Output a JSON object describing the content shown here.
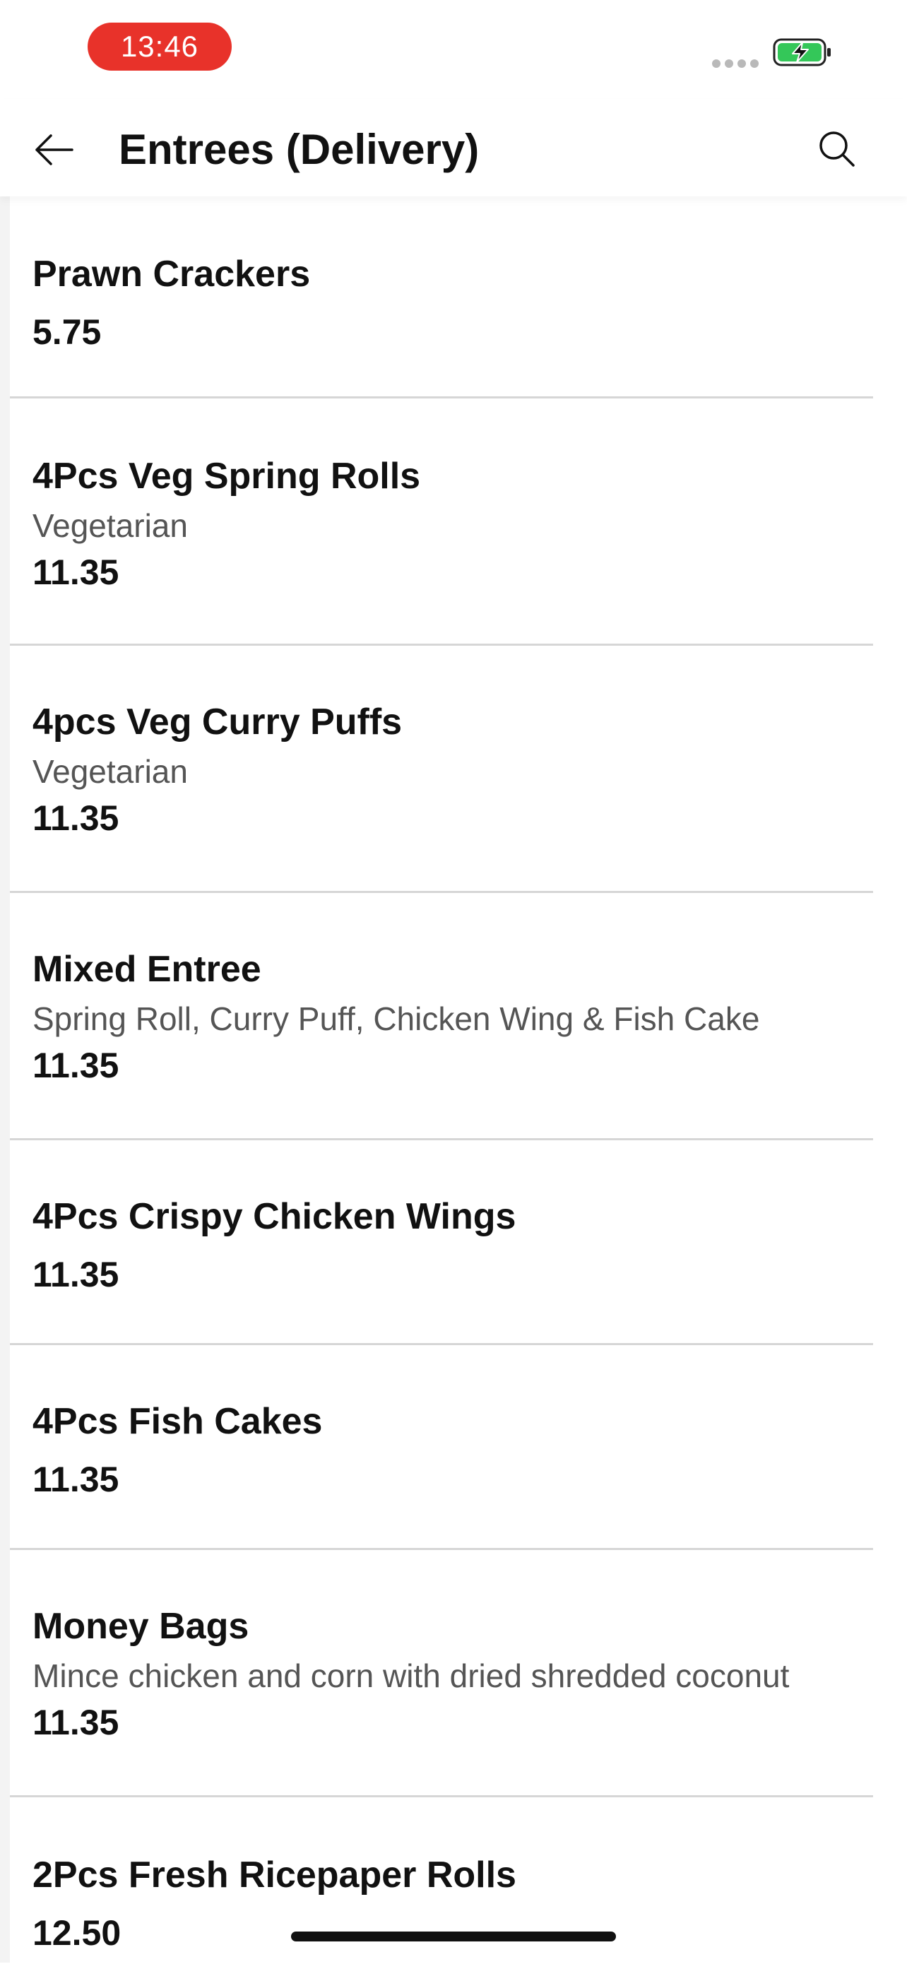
{
  "status_bar": {
    "time": "13:46",
    "time_pill_color": "#e8322a",
    "battery_color": "#34c759",
    "battery_icon": "battery-charging-icon"
  },
  "header": {
    "title": "Entrees (Delivery)",
    "back_icon": "arrow-left-icon",
    "search_icon": "search-icon"
  },
  "items": [
    {
      "name": "Prawn Crackers",
      "description": "",
      "price": "5.75"
    },
    {
      "name": "4Pcs Veg Spring Rolls",
      "description": "Vegetarian",
      "price": "11.35"
    },
    {
      "name": "4pcs Veg Curry Puffs",
      "description": "Vegetarian",
      "price": "11.35"
    },
    {
      "name": "Mixed Entree",
      "description": "Spring Roll, Curry Puff, Chicken Wing & Fish Cake",
      "price": "11.35"
    },
    {
      "name": "4Pcs Crispy Chicken Wings",
      "description": "",
      "price": "11.35"
    },
    {
      "name": "4Pcs Fish Cakes",
      "description": "",
      "price": "11.35"
    },
    {
      "name": "Money Bags",
      "description": "Mince chicken and corn with dried shredded coconut",
      "price": "11.35"
    },
    {
      "name": "2Pcs Fresh Ricepaper Rolls",
      "description": "",
      "price": "12.50"
    }
  ]
}
